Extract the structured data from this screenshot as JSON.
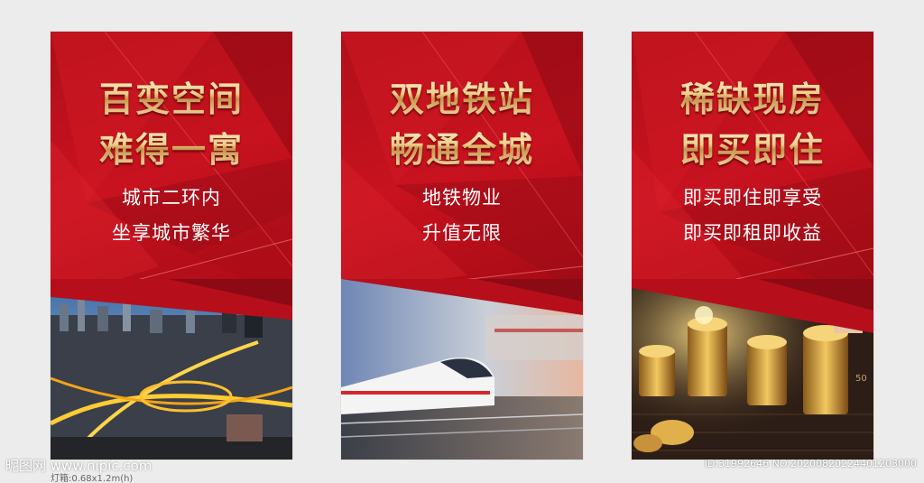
{
  "panels": [
    {
      "headline_1": "百变空间",
      "headline_2": "难得一寓",
      "sub_1": "城市二环内",
      "sub_2": "坐享城市繁华",
      "photo": "city-night-overpass"
    },
    {
      "headline_1": "双地铁站",
      "headline_2": "畅通全城",
      "sub_1": "地铁物业",
      "sub_2": "升值无限",
      "photo": "high-speed-train"
    },
    {
      "headline_1": "稀缺现房",
      "headline_2": "即买即住",
      "sub_1": "即买即住即享受",
      "sub_2": "即买即租即收益",
      "photo": "gold-coin-stacks"
    }
  ],
  "chart_axis_label": "50",
  "caption": "灯箱:0.68x1.2m(h)",
  "watermark_left": "昵图网 www.nipic.com",
  "watermark_right": "ID:31992646 NO:20200820224401203000",
  "colors": {
    "panel_red": "#c8121f",
    "gold_text": "#f0cf8a",
    "page_bg": "#ececec"
  }
}
